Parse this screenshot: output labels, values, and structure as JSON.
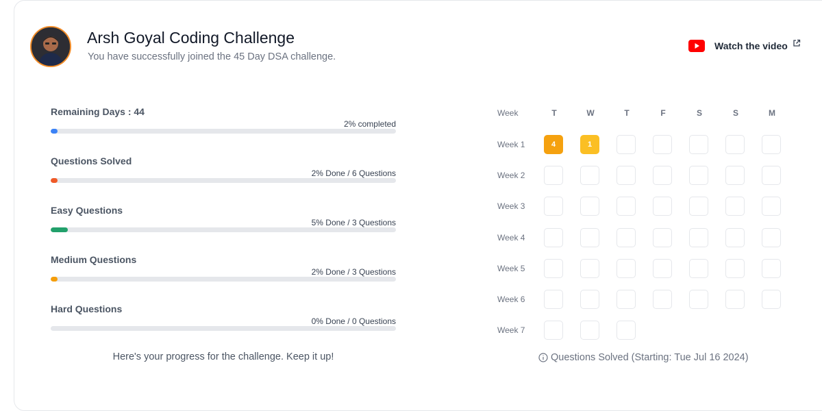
{
  "header": {
    "title": "Arsh Goyal Coding Challenge",
    "subtitle": "You have successfully joined the 45 Day DSA challenge.",
    "video_link": {
      "label": "Watch the video",
      "icon": "youtube-icon",
      "external_icon": "external-link-icon"
    },
    "avatar": {
      "icon": "user-avatar",
      "border_color": "#f28c28"
    }
  },
  "progress": [
    {
      "label": "Remaining Days : 44",
      "status": "2% completed",
      "percent": 2,
      "color": "#3b82f6"
    },
    {
      "label": "Questions Solved",
      "status": "2% Done / 6 Questions",
      "percent": 2,
      "color": "#ef5a28"
    },
    {
      "label": "Easy Questions",
      "status": "5% Done / 3 Questions",
      "percent": 5,
      "color": "#22a06b"
    },
    {
      "label": "Medium Questions",
      "status": "2% Done / 3 Questions",
      "percent": 2,
      "color": "#f59e0b"
    },
    {
      "label": "Hard Questions",
      "status": "0% Done / 0 Questions",
      "percent": 0,
      "color": "#ef4444"
    }
  ],
  "progress_footer": "Here's your progress for the challenge. Keep it up!",
  "calendar": {
    "week_header": "Week",
    "days": [
      "T",
      "W",
      "T",
      "F",
      "S",
      "S",
      "M"
    ],
    "weeks": [
      {
        "label": "Week 1",
        "cells": [
          {
            "value": "4",
            "color": "#f5a10f"
          },
          {
            "value": "1",
            "color": "#fbbf24"
          },
          {
            "value": ""
          },
          {
            "value": ""
          },
          {
            "value": ""
          },
          {
            "value": ""
          },
          {
            "value": ""
          }
        ]
      },
      {
        "label": "Week 2",
        "cells": [
          {
            "value": ""
          },
          {
            "value": ""
          },
          {
            "value": ""
          },
          {
            "value": ""
          },
          {
            "value": ""
          },
          {
            "value": ""
          },
          {
            "value": ""
          }
        ]
      },
      {
        "label": "Week 3",
        "cells": [
          {
            "value": ""
          },
          {
            "value": ""
          },
          {
            "value": ""
          },
          {
            "value": ""
          },
          {
            "value": ""
          },
          {
            "value": ""
          },
          {
            "value": ""
          }
        ]
      },
      {
        "label": "Week 4",
        "cells": [
          {
            "value": ""
          },
          {
            "value": ""
          },
          {
            "value": ""
          },
          {
            "value": ""
          },
          {
            "value": ""
          },
          {
            "value": ""
          },
          {
            "value": ""
          }
        ]
      },
      {
        "label": "Week 5",
        "cells": [
          {
            "value": ""
          },
          {
            "value": ""
          },
          {
            "value": ""
          },
          {
            "value": ""
          },
          {
            "value": ""
          },
          {
            "value": ""
          },
          {
            "value": ""
          }
        ]
      },
      {
        "label": "Week 6",
        "cells": [
          {
            "value": ""
          },
          {
            "value": ""
          },
          {
            "value": ""
          },
          {
            "value": ""
          },
          {
            "value": ""
          },
          {
            "value": ""
          },
          {
            "value": ""
          }
        ]
      },
      {
        "label": "Week 7",
        "cells": [
          {
            "value": ""
          },
          {
            "value": ""
          },
          {
            "value": ""
          }
        ]
      }
    ],
    "footer": "Questions Solved (Starting: Tue Jul 16 2024)",
    "footer_icon": "info-icon"
  }
}
